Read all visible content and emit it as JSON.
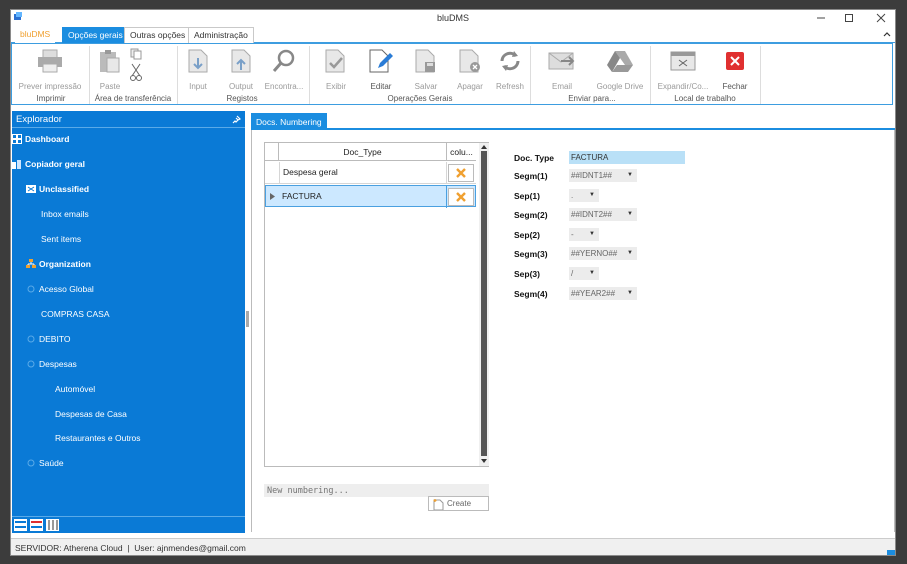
{
  "window": {
    "title": "bluDMS"
  },
  "ribbon_tabs": [
    {
      "label": "bluDMS"
    },
    {
      "label": "Opções gerais"
    },
    {
      "label": "Outras opções"
    },
    {
      "label": "Administração"
    }
  ],
  "ribbon": {
    "buttons": {
      "prever": "Prever impressão",
      "paste": "Paste",
      "input": "Input",
      "output": "Output",
      "encontrar": "Encontra...",
      "exibir": "Exibir",
      "editar": "Editar",
      "salvar": "Salvar",
      "apagar": "Apagar",
      "refresh": "Refresh",
      "email": "Email",
      "gdrive": "Google Drive",
      "expandir": "Expandir/Co...",
      "fechar": "Fechar"
    },
    "groups": {
      "imprimir": "Imprimir",
      "transferencia": "Área de transferência",
      "registos": "Registos",
      "operacoes": "Operações Gerais",
      "enviar": "Enviar para...",
      "local": "Local de trabalho"
    }
  },
  "sidebar": {
    "header": "Explorador",
    "items": [
      {
        "label": "Dashboard"
      },
      {
        "label": "Copiador geral"
      },
      {
        "label": "Unclassified"
      },
      {
        "label": "Inbox emails"
      },
      {
        "label": "Sent items"
      },
      {
        "label": "Organization"
      },
      {
        "label": "Acesso Global"
      },
      {
        "label": "COMPRAS CASA"
      },
      {
        "label": "DEBITO"
      },
      {
        "label": "Despesas"
      },
      {
        "label": "Automóvel"
      },
      {
        "label": "Despesas de Casa"
      },
      {
        "label": "Restaurantes e Outros"
      },
      {
        "label": "Saúde"
      }
    ]
  },
  "doc_tab": {
    "label": "Docs. Numbering"
  },
  "grid": {
    "columns": [
      "Doc_Type",
      "colu..."
    ],
    "rows": [
      {
        "doc_type": "Despesa geral"
      },
      {
        "doc_type": "FACTURA"
      }
    ]
  },
  "new_numbering": {
    "placeholder": "New numbering..."
  },
  "create_button": {
    "label": "Create"
  },
  "form": {
    "doc_type": {
      "label": "Doc. Type",
      "value": "FACTURA"
    },
    "segm1": {
      "label": "Segm(1)",
      "value": "##IDNT1##"
    },
    "sep1": {
      "label": "Sep(1)",
      "value": "."
    },
    "segm2": {
      "label": "Segm(2)",
      "value": "##IDNT2##"
    },
    "sep2": {
      "label": "Sep(2)",
      "value": "-"
    },
    "segm3": {
      "label": "Segm(3)",
      "value": "##YERNO##"
    },
    "sep3": {
      "label": "Sep(3)",
      "value": "/"
    },
    "segm4": {
      "label": "Segm(4)",
      "value": "##YEAR2##"
    }
  },
  "status": {
    "text": "SERVIDOR: Atherena Cloud  |  User: ajnmendes@gmail.com"
  },
  "colors": {
    "accent": "#1b8de0",
    "sidebar": "#0a7ad6",
    "delete": "#f0a030",
    "close": "#e03030"
  }
}
